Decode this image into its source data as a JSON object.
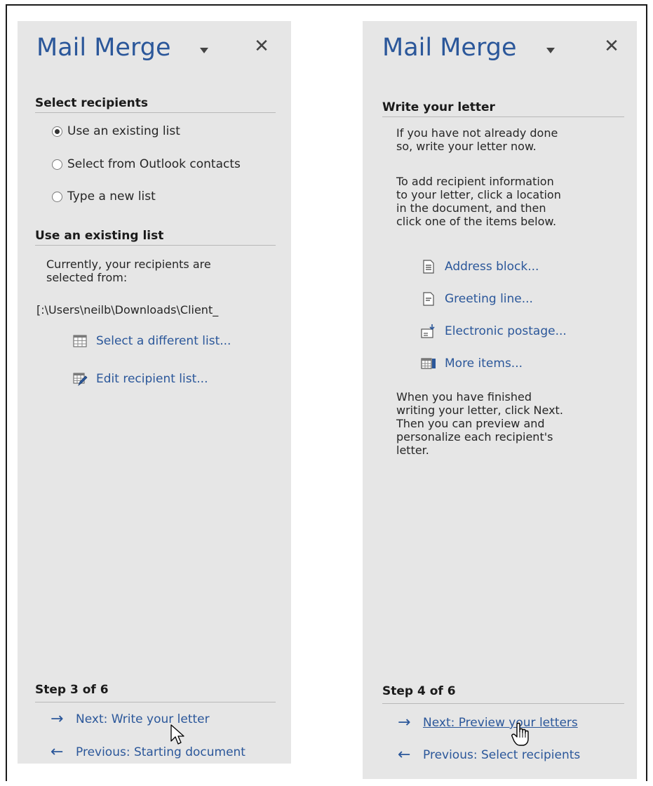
{
  "panes": [
    {
      "title": "Mail Merge",
      "select_recipients": {
        "heading": "Select recipients",
        "options": [
          {
            "label": "Use an existing list",
            "selected": true
          },
          {
            "label": "Select from Outlook contacts",
            "selected": false
          },
          {
            "label": "Type a new list",
            "selected": false
          }
        ]
      },
      "existing_list": {
        "heading": "Use an existing list",
        "description": "Currently, your recipients are\nselected from:",
        "path": "[:\\Users\\neilb\\Downloads\\Client_",
        "select_link": "Select a different list...",
        "edit_link": "Edit recipient list..."
      },
      "step": "Step 3 of 6",
      "next_label": "Next: Write your letter",
      "previous_label": "Previous: Starting document"
    },
    {
      "title": "Mail Merge",
      "write_letter": {
        "heading": "Write your letter",
        "intro": "If you have not already done\nso, write your letter now.",
        "instructions": "To add recipient information\nto your letter, click a location\nin the document, and then\nclick one of the items below.",
        "items": [
          {
            "label": "Address block...",
            "icon": "address-block-icon"
          },
          {
            "label": "Greeting line...",
            "icon": "greeting-line-icon"
          },
          {
            "label": "Electronic postage...",
            "icon": "electronic-postage-icon"
          },
          {
            "label": "More items...",
            "icon": "more-items-icon"
          }
        ],
        "finish_text": "When you have finished\nwriting your letter, click Next.\nThen you can preview and\npersonalize each recipient's\nletter."
      },
      "step": "Step 4 of 6",
      "next_label": "Next: Preview your letters",
      "previous_label": "Previous: Select recipients"
    }
  ],
  "icons": {
    "next_arrow": "→",
    "previous_arrow": "←",
    "close": "✕"
  },
  "colors": {
    "accent": "#2b579a",
    "pane_background": "#e6e6e6"
  }
}
